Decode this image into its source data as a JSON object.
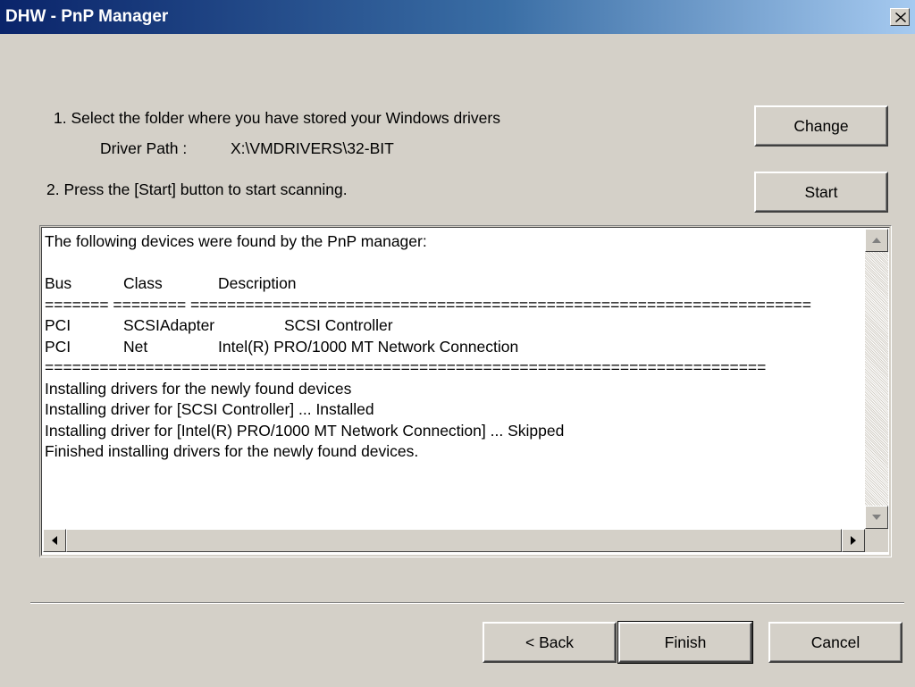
{
  "window": {
    "title": "DHW - PnP Manager",
    "close_icon": "close-icon"
  },
  "step1": {
    "label": "1. Select the folder where you have stored your Windows drivers",
    "path_prefix": "Driver Path :",
    "path_value": "X:\\VMDRIVERS\\32-BIT",
    "change_label": "Change"
  },
  "step2": {
    "label": "2. Press the [Start] button to start scanning.",
    "start_label": "Start"
  },
  "log": {
    "intro": "The following devices were found by the PnP manager:",
    "headers": {
      "bus": "Bus",
      "class": "Class",
      "description": "Description"
    },
    "header_separator": "======= ======== ====================================================================",
    "devices": [
      {
        "bus": "PCI",
        "class": "SCSIAdapter",
        "description": "SCSI Controller"
      },
      {
        "bus": "PCI",
        "class": "Net",
        "description": "Intel(R) PRO/1000 MT Network Connection"
      }
    ],
    "footer_separator": "===============================================================================",
    "messages": [
      "Installing drivers for the newly found devices",
      "Installing driver for [SCSI Controller] ... Installed",
      "Installing driver for [Intel(R) PRO/1000 MT Network Connection] ... Skipped",
      "Finished installing drivers for the newly found devices."
    ]
  },
  "footer": {
    "back_label": "< Back",
    "finish_label": "Finish",
    "cancel_label": "Cancel"
  },
  "colors": {
    "titlebar_start": "#0a246a",
    "titlebar_end": "#a6caf0",
    "dialog_bg": "#d4d0c8"
  }
}
